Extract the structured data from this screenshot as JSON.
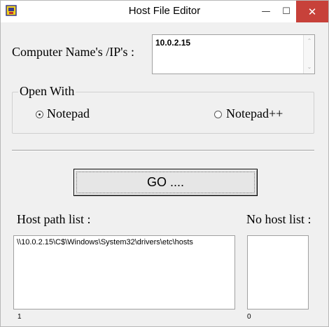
{
  "window": {
    "title": "Host File Editor",
    "minimize_glyph": "—",
    "maximize_glyph": "☐",
    "close_glyph": "✕",
    "icon": "app-icon"
  },
  "computer": {
    "label": "Computer Name's /IP's :",
    "value": "10.0.2.15",
    "scroll_up": "⌃",
    "scroll_down": "⌄"
  },
  "open_with": {
    "title": "Open With",
    "options": [
      {
        "label": "Notepad",
        "checked": true
      },
      {
        "label": "Notepad++",
        "checked": false
      }
    ]
  },
  "go_button": {
    "label": "GO ...."
  },
  "host_path": {
    "label": "Host path list :",
    "items": [
      "\\\\10.0.2.15\\C$\\Windows\\System32\\drivers\\etc\\hosts"
    ],
    "count": "1"
  },
  "no_host": {
    "label": "No host list :",
    "items": [],
    "count": "0"
  }
}
